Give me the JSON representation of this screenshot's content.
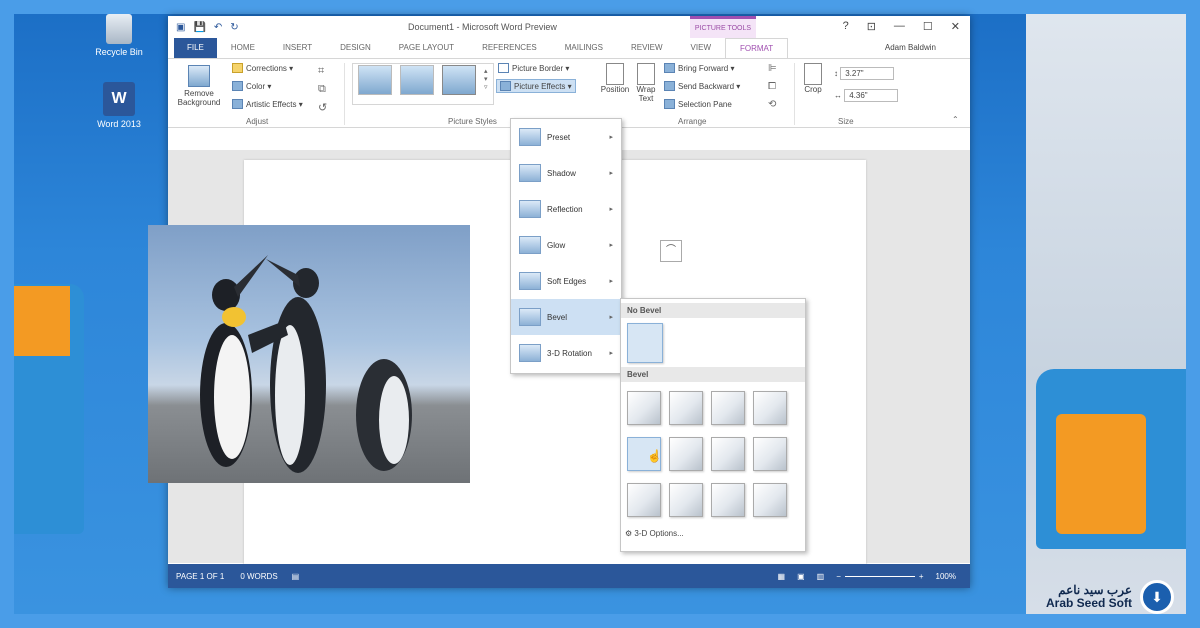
{
  "desktop": {
    "icons": [
      {
        "label": "Recycle Bin",
        "icon": "recycle-bin-icon"
      },
      {
        "label": "Word 2013",
        "icon": "word-icon"
      }
    ]
  },
  "window": {
    "doc_title": "Document1 - Microsoft Word Preview",
    "context_tab": "PICTURE TOOLS",
    "controls": [
      "?",
      "⊡",
      "—",
      "☐",
      "✕"
    ],
    "user": "Adam Baldwin"
  },
  "tabs": [
    "FILE",
    "HOME",
    "INSERT",
    "DESIGN",
    "PAGE LAYOUT",
    "REFERENCES",
    "MAILINGS",
    "REVIEW",
    "VIEW",
    "FORMAT"
  ],
  "ribbon": {
    "adjust": {
      "remove_background": "Remove Background",
      "corrections": "Corrections",
      "color": "Color",
      "artistic_effects": "Artistic Effects",
      "label": "Adjust"
    },
    "picture_styles": {
      "picture_border": "Picture Border",
      "picture_effects": "Picture Effects",
      "label": "Picture Styles"
    },
    "arrange": {
      "position": "Position",
      "wrap_text": "Wrap Text",
      "bring_forward": "Bring Forward",
      "send_backward": "Send Backward",
      "selection_pane": "Selection Pane",
      "label": "Arrange"
    },
    "size": {
      "crop": "Crop",
      "height": "3.27\"",
      "width": "4.36\"",
      "label": "Size"
    }
  },
  "effects_menu": [
    {
      "label": "Preset",
      "highlighted": false
    },
    {
      "label": "Shadow",
      "highlighted": false
    },
    {
      "label": "Reflection",
      "highlighted": false
    },
    {
      "label": "Glow",
      "highlighted": false
    },
    {
      "label": "Soft Edges",
      "highlighted": false
    },
    {
      "label": "Bevel",
      "highlighted": true
    },
    {
      "label": "3-D Rotation",
      "highlighted": false
    }
  ],
  "bevel_panel": {
    "no_bevel_header": "No Bevel",
    "bevel_header": "Bevel",
    "options_link": "3-D Options..."
  },
  "status": {
    "page": "PAGE 1 OF 1",
    "words": "0 WORDS",
    "zoom": "100%"
  },
  "watermark": {
    "arabic": "عرب سيد ناعم",
    "latin": "Arab Seed Soft"
  },
  "colors": {
    "word_blue": "#2b579a",
    "picture_tools_purple": "#a04fb0",
    "menu_highlight": "#cde0f3"
  }
}
